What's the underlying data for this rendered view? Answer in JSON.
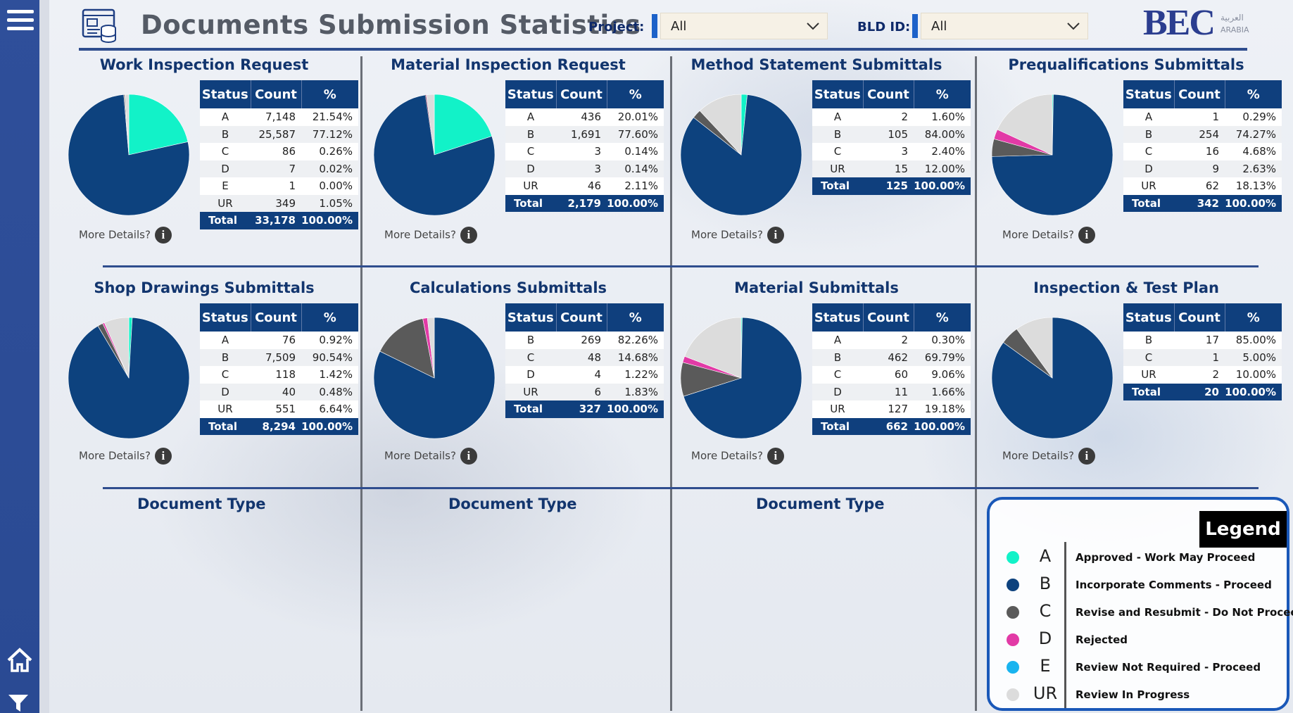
{
  "header": {
    "title": "Documents Submission Statistics",
    "project_label": "Project:",
    "project_value": "All",
    "bld_label": "BLD ID:",
    "bld_value": "All",
    "logo_text": "BEC",
    "logo_arabic": "العربية",
    "logo_sub": "ARABIA"
  },
  "colors": {
    "A": "#12f2c8",
    "B": "#0d427e",
    "C": "#5a5a5a",
    "D": "#e23aa6",
    "E": "#19b4ef",
    "UR": "#dcdcdc",
    "accent": "#0f3f7d"
  },
  "table_headers": {
    "status": "Status",
    "count": "Count",
    "pct": "%"
  },
  "more_details": "More Details?",
  "panels": [
    {
      "title": "Work Inspection Request",
      "rows": [
        {
          "status": "A",
          "count": "7,148",
          "pct": "21.54%",
          "value": 21.54
        },
        {
          "status": "B",
          "count": "25,587",
          "pct": "77.12%",
          "value": 77.12
        },
        {
          "status": "C",
          "count": "86",
          "pct": "0.26%",
          "value": 0.26
        },
        {
          "status": "D",
          "count": "7",
          "pct": "0.02%",
          "value": 0.02
        },
        {
          "status": "E",
          "count": "1",
          "pct": "0.00%",
          "value": 0.0
        },
        {
          "status": "UR",
          "count": "349",
          "pct": "1.05%",
          "value": 1.05
        }
      ],
      "total": {
        "label": "Total",
        "count": "33,178",
        "pct": "100.00%"
      }
    },
    {
      "title": "Material Inspection Request",
      "rows": [
        {
          "status": "A",
          "count": "436",
          "pct": "20.01%",
          "value": 20.01
        },
        {
          "status": "B",
          "count": "1,691",
          "pct": "77.60%",
          "value": 77.6
        },
        {
          "status": "C",
          "count": "3",
          "pct": "0.14%",
          "value": 0.14
        },
        {
          "status": "D",
          "count": "3",
          "pct": "0.14%",
          "value": 0.14
        },
        {
          "status": "UR",
          "count": "46",
          "pct": "2.11%",
          "value": 2.11
        }
      ],
      "total": {
        "label": "Total",
        "count": "2,179",
        "pct": "100.00%"
      }
    },
    {
      "title": "Method Statement Submittals",
      "rows": [
        {
          "status": "A",
          "count": "2",
          "pct": "1.60%",
          "value": 1.6
        },
        {
          "status": "B",
          "count": "105",
          "pct": "84.00%",
          "value": 84.0
        },
        {
          "status": "C",
          "count": "3",
          "pct": "2.40%",
          "value": 2.4
        },
        {
          "status": "UR",
          "count": "15",
          "pct": "12.00%",
          "value": 12.0
        }
      ],
      "total": {
        "label": "Total",
        "count": "125",
        "pct": "100.00%"
      }
    },
    {
      "title": "Prequalifications Submittals",
      "rows": [
        {
          "status": "A",
          "count": "1",
          "pct": "0.29%",
          "value": 0.29
        },
        {
          "status": "B",
          "count": "254",
          "pct": "74.27%",
          "value": 74.27
        },
        {
          "status": "C",
          "count": "16",
          "pct": "4.68%",
          "value": 4.68
        },
        {
          "status": "D",
          "count": "9",
          "pct": "2.63%",
          "value": 2.63
        },
        {
          "status": "UR",
          "count": "62",
          "pct": "18.13%",
          "value": 18.13
        }
      ],
      "total": {
        "label": "Total",
        "count": "342",
        "pct": "100.00%"
      }
    },
    {
      "title": "Shop Drawings Submittals",
      "rows": [
        {
          "status": "A",
          "count": "76",
          "pct": "0.92%",
          "value": 0.92
        },
        {
          "status": "B",
          "count": "7,509",
          "pct": "90.54%",
          "value": 90.54
        },
        {
          "status": "C",
          "count": "118",
          "pct": "1.42%",
          "value": 1.42
        },
        {
          "status": "D",
          "count": "40",
          "pct": "0.48%",
          "value": 0.48
        },
        {
          "status": "UR",
          "count": "551",
          "pct": "6.64%",
          "value": 6.64
        }
      ],
      "total": {
        "label": "Total",
        "count": "8,294",
        "pct": "100.00%"
      }
    },
    {
      "title": "Calculations Submittals",
      "rows": [
        {
          "status": "B",
          "count": "269",
          "pct": "82.26%",
          "value": 82.26
        },
        {
          "status": "C",
          "count": "48",
          "pct": "14.68%",
          "value": 14.68
        },
        {
          "status": "D",
          "count": "4",
          "pct": "1.22%",
          "value": 1.22
        },
        {
          "status": "UR",
          "count": "6",
          "pct": "1.83%",
          "value": 1.83
        }
      ],
      "total": {
        "label": "Total",
        "count": "327",
        "pct": "100.00%"
      }
    },
    {
      "title": "Material Submittals",
      "rows": [
        {
          "status": "A",
          "count": "2",
          "pct": "0.30%",
          "value": 0.3
        },
        {
          "status": "B",
          "count": "462",
          "pct": "69.79%",
          "value": 69.79
        },
        {
          "status": "C",
          "count": "60",
          "pct": "9.06%",
          "value": 9.06
        },
        {
          "status": "D",
          "count": "11",
          "pct": "1.66%",
          "value": 1.66
        },
        {
          "status": "UR",
          "count": "127",
          "pct": "19.18%",
          "value": 19.18
        }
      ],
      "total": {
        "label": "Total",
        "count": "662",
        "pct": "100.00%"
      }
    },
    {
      "title": "Inspection & Test Plan",
      "rows": [
        {
          "status": "B",
          "count": "17",
          "pct": "85.00%",
          "value": 85.0
        },
        {
          "status": "C",
          "count": "1",
          "pct": "5.00%",
          "value": 5.0
        },
        {
          "status": "UR",
          "count": "2",
          "pct": "10.00%",
          "value": 10.0
        }
      ],
      "total": {
        "label": "Total",
        "count": "20",
        "pct": "100.00%"
      }
    }
  ],
  "doc_types": [
    "Document Type",
    "Document Type",
    "Document Type"
  ],
  "legend": {
    "title": "Legend",
    "items": [
      {
        "code": "A",
        "desc": "Approved - Work May Proceed",
        "color": "#12f2c8"
      },
      {
        "code": "B",
        "desc": "Incorporate Comments - Proceed",
        "color": "#0d427e"
      },
      {
        "code": "C",
        "desc": "Revise and Resubmit - Do Not Proceed",
        "color": "#5a5a5a"
      },
      {
        "code": "D",
        "desc": "Rejected",
        "color": "#e23aa6"
      },
      {
        "code": "E",
        "desc": "Review Not Required - Proceed",
        "color": "#19b4ef"
      },
      {
        "code": "UR",
        "desc": "Review In Progress",
        "color": "#dcdcdc"
      }
    ]
  },
  "chart_data": [
    {
      "type": "pie",
      "title": "Work Inspection Request",
      "categories": [
        "A",
        "B",
        "C",
        "D",
        "E",
        "UR"
      ],
      "values": [
        21.54,
        77.12,
        0.26,
        0.02,
        0.0,
        1.05
      ]
    },
    {
      "type": "pie",
      "title": "Material Inspection Request",
      "categories": [
        "A",
        "B",
        "C",
        "D",
        "UR"
      ],
      "values": [
        20.01,
        77.6,
        0.14,
        0.14,
        2.11
      ]
    },
    {
      "type": "pie",
      "title": "Method Statement Submittals",
      "categories": [
        "A",
        "B",
        "C",
        "UR"
      ],
      "values": [
        1.6,
        84.0,
        2.4,
        12.0
      ]
    },
    {
      "type": "pie",
      "title": "Prequalifications Submittals",
      "categories": [
        "A",
        "B",
        "C",
        "D",
        "UR"
      ],
      "values": [
        0.29,
        74.27,
        4.68,
        2.63,
        18.13
      ]
    },
    {
      "type": "pie",
      "title": "Shop Drawings Submittals",
      "categories": [
        "A",
        "B",
        "C",
        "D",
        "UR"
      ],
      "values": [
        0.92,
        90.54,
        1.42,
        0.48,
        6.64
      ]
    },
    {
      "type": "pie",
      "title": "Calculations Submittals",
      "categories": [
        "B",
        "C",
        "D",
        "UR"
      ],
      "values": [
        82.26,
        14.68,
        1.22,
        1.83
      ]
    },
    {
      "type": "pie",
      "title": "Material Submittals",
      "categories": [
        "A",
        "B",
        "C",
        "D",
        "UR"
      ],
      "values": [
        0.3,
        69.79,
        9.06,
        1.66,
        19.18
      ]
    },
    {
      "type": "pie",
      "title": "Inspection & Test Plan",
      "categories": [
        "B",
        "C",
        "UR"
      ],
      "values": [
        85.0,
        5.0,
        10.0
      ]
    }
  ]
}
